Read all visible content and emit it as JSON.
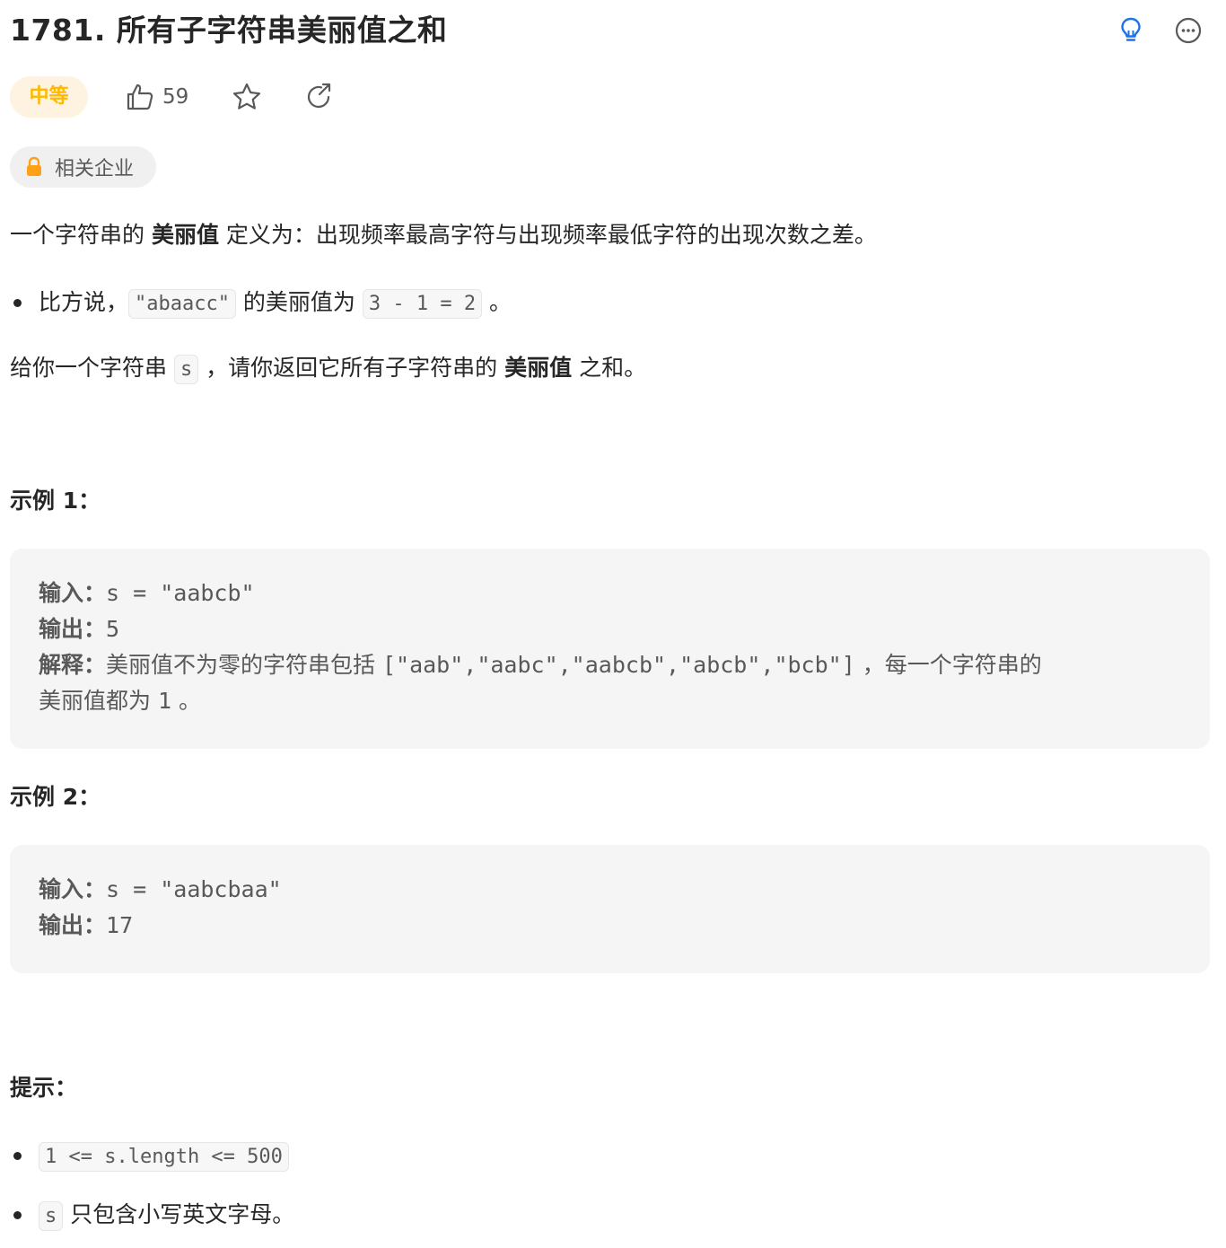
{
  "problem": {
    "title": "1781. 所有子字符串美丽值之和",
    "difficulty": "中等",
    "likes": "59",
    "company_tag": "相关企业"
  },
  "description": {
    "p1_pre": "一个字符串的 ",
    "p1_bold": "美丽值",
    "p1_post": " 定义为：出现频率最高字符与出现频率最低字符的出现次数之差。",
    "bullet_pre": "比方说，",
    "bullet_code1": "\"abaacc\"",
    "bullet_mid": " 的美丽值为 ",
    "bullet_code2": "3 - 1 = 2",
    "bullet_post": " 。",
    "p2_pre": "给你一个字符串 ",
    "p2_code": "s",
    "p2_mid": " ，请你返回它所有子字符串的 ",
    "p2_bold": "美丽值",
    "p2_post": " 之和。"
  },
  "examples": [
    {
      "title": "示例 1：",
      "input_label": "输入：",
      "input_value": "s = \"aabcb\"",
      "output_label": "输出：",
      "output_value": "5",
      "explain_label": "解释：",
      "explain_text1": "美丽值不为零的字符串包括 ",
      "explain_code": "[\"aab\",\"aabc\",\"aabcb\",\"abcb\",\"bcb\"]",
      "explain_text2": " ，每一个字符串的",
      "explain_text3": "美丽值都为 ",
      "explain_code2": "1",
      "explain_text4": " 。"
    },
    {
      "title": "示例 2：",
      "input_label": "输入：",
      "input_value": "s = \"aabcbaa\"",
      "output_label": "输出：",
      "output_value": "17"
    }
  ],
  "constraints": {
    "title": "提示：",
    "c1_code": "1 <= s.length <= 500",
    "c2_code": "s",
    "c2_text": " 只包含小写英文字母。"
  },
  "icons": {
    "hint": "lightbulb-icon",
    "more": "more-icon",
    "like": "thumbs-up-icon",
    "star": "star-icon",
    "share": "share-icon",
    "lock": "lock-icon"
  },
  "colors": {
    "difficulty_text": "#ffb800",
    "difficulty_bg": "#fef3e0",
    "hint_icon": "#1a73e8",
    "lock_icon": "#ffa116"
  }
}
